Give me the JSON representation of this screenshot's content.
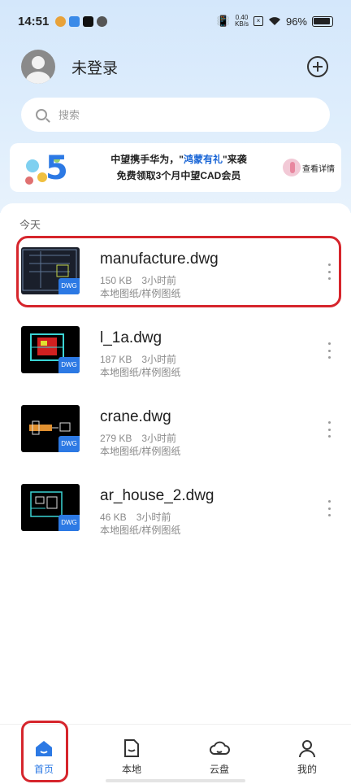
{
  "status_bar": {
    "time": "14:51",
    "net_speed": "0.40",
    "net_unit": "KB/s",
    "battery": "96%"
  },
  "header": {
    "user_name": "未登录"
  },
  "search": {
    "placeholder": "搜索"
  },
  "banner": {
    "line1_pre": "中望携手华为，\"",
    "line1_highlight": "鸿蒙有礼",
    "line1_post": "\"来袭",
    "line2": "免费领取3个月中望CAD会员",
    "cta": "查看详情",
    "art_number": "5"
  },
  "files": {
    "section_label": "今天",
    "items": [
      {
        "name": "manufacture.dwg",
        "size": "150 KB",
        "time": "3小时前",
        "location": "本地图纸/样例图纸",
        "tag": "DWG"
      },
      {
        "name": "l_1a.dwg",
        "size": "187 KB",
        "time": "3小时前",
        "location": "本地图纸/样例图纸",
        "tag": "DWG"
      },
      {
        "name": "crane.dwg",
        "size": "279 KB",
        "time": "3小时前",
        "location": "本地图纸/样例图纸",
        "tag": "DWG"
      },
      {
        "name": "ar_house_2.dwg",
        "size": "46 KB",
        "time": "3小时前",
        "location": "本地图纸/样例图纸",
        "tag": "DWG"
      }
    ]
  },
  "nav": {
    "items": [
      {
        "label": "首页",
        "icon": "home-icon",
        "active": true
      },
      {
        "label": "本地",
        "icon": "local-file-icon",
        "active": false
      },
      {
        "label": "云盘",
        "icon": "cloud-icon",
        "active": false
      },
      {
        "label": "我的",
        "icon": "person-icon",
        "active": false
      }
    ]
  },
  "colors": {
    "accent": "#2c79e4",
    "highlight": "#d6252c",
    "top_bg": "#d4e7fb"
  }
}
